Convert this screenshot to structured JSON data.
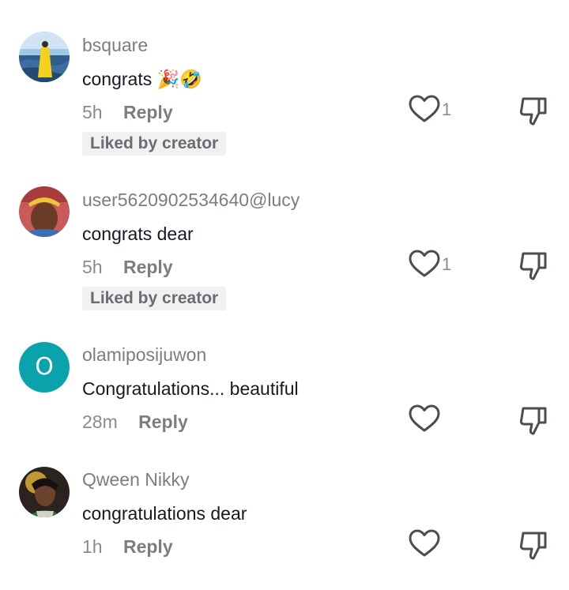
{
  "comments": [
    {
      "username": "bsquare",
      "text": "congrats",
      "emoji": "🎉🤣",
      "time": "5h",
      "reply_label": "Reply",
      "like_count": "1",
      "badge": "Liked by creator"
    },
    {
      "username": "user5620902534640@lucy",
      "text": "congrats dear",
      "time": "5h",
      "reply_label": "Reply",
      "like_count": "1",
      "badge": "Liked by creator"
    },
    {
      "username": "olamiposijuwon",
      "avatar_letter": "O",
      "text": "Congratulations... beautiful",
      "time": "28m",
      "reply_label": "Reply"
    },
    {
      "username": "Qween Nikky",
      "text": "congratulations dear",
      "time": "1h",
      "reply_label": "Reply"
    }
  ],
  "colors": {
    "username": "#7b7d82",
    "text": "#161823",
    "badge_bg": "#f1f1f2",
    "letter_avatar_bg": "#0aa2ab"
  },
  "icons": {
    "like": "heart-outline-icon",
    "dislike": "thumbs-down-outline-icon"
  }
}
